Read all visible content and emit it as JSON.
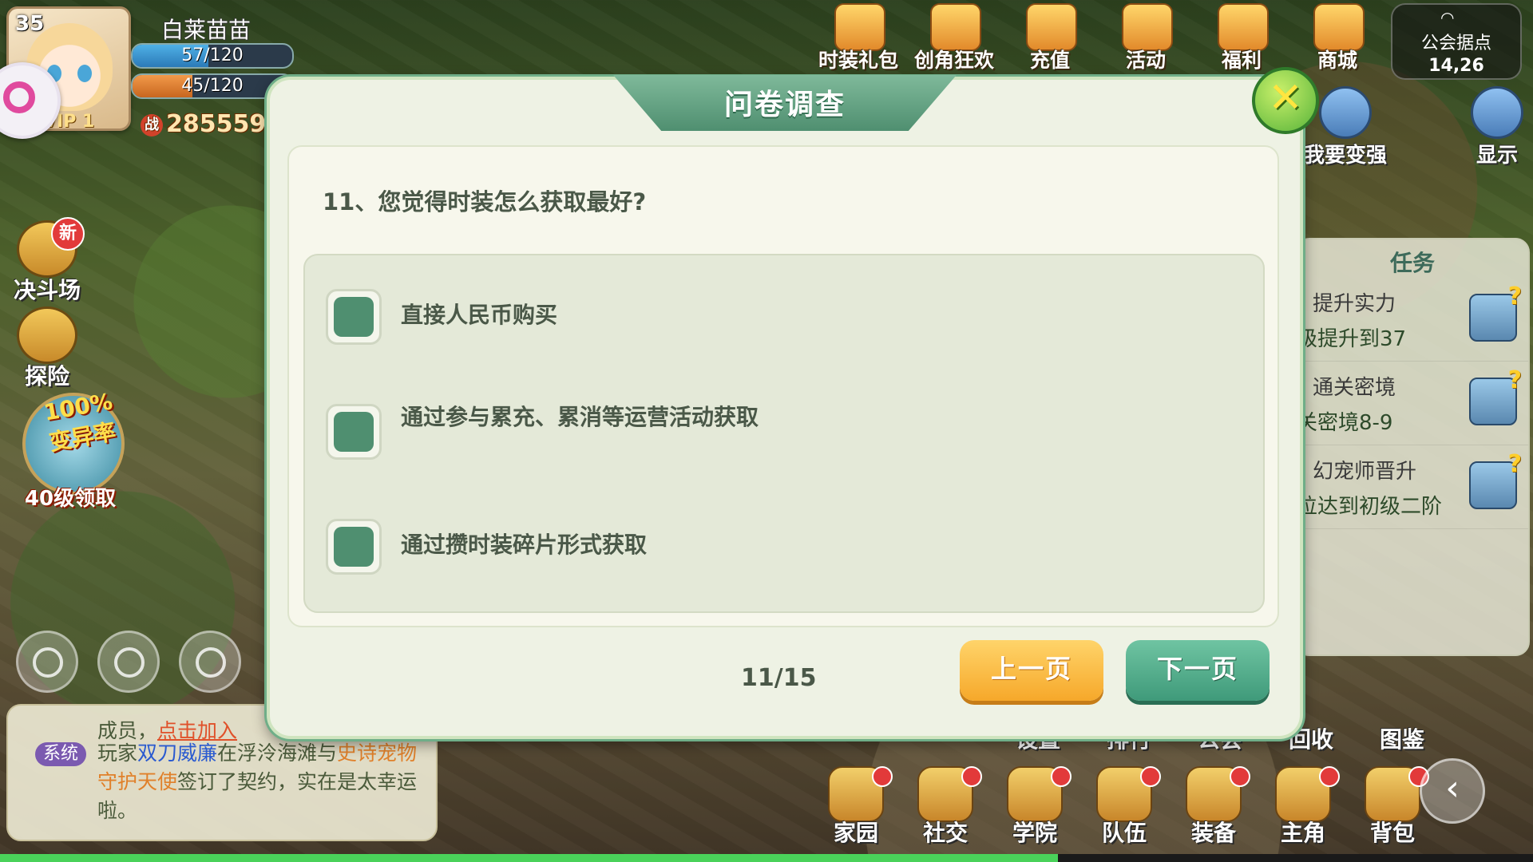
{
  "player": {
    "level": "35",
    "name": "白莱苗苗",
    "hp": "57/120",
    "hp_fill": 0.475,
    "energy": "45/120",
    "energy_fill": 0.375,
    "vip": "VIP 1",
    "power_icon": "战",
    "power": "285559"
  },
  "top_menu": [
    {
      "label": "时装礼包",
      "icon": "gift-icon"
    },
    {
      "label": "创角狂欢",
      "icon": "party-icon"
    },
    {
      "label": "充值",
      "icon": "coin-icon"
    },
    {
      "label": "活动",
      "icon": "event-icon"
    },
    {
      "label": "福利",
      "icon": "welfare-icon"
    },
    {
      "label": "商城",
      "icon": "shop-icon"
    }
  ],
  "guild": {
    "line1": "公会据点",
    "line2": "14,26"
  },
  "side": {
    "strengthen": "我要变强",
    "display": "显示"
  },
  "left_menu": {
    "arena": "决斗场",
    "arena_badge": "新",
    "explore": "探险",
    "promo_big": "100%变异率",
    "promo_label": "40级领取"
  },
  "chat": {
    "line1_prefix": "成员，",
    "line1_link": "点击加入",
    "sys_tag": "系统",
    "msg_a": "玩家",
    "msg_player": "双刀威廉",
    "msg_b": "在浮泠海滩与",
    "msg_rarity": "史诗宠物",
    "msg_pet": "守护天使",
    "msg_c": "签订了契约，实在是太幸运啦。"
  },
  "bottom_row2": [
    "设置",
    "排行",
    "公会",
    "回收",
    "图鉴"
  ],
  "bottom_menu": [
    "家园",
    "社交",
    "学院",
    "队伍",
    "装备",
    "主角",
    "背包"
  ],
  "quest": {
    "title": "任务",
    "items": [
      {
        "name": "提升实力",
        "desc": "级提升到37"
      },
      {
        "name": "通关密境",
        "desc": "关密境8-9"
      },
      {
        "name": "幻宠师晋升",
        "desc": "位达到初级二阶"
      }
    ]
  },
  "dialog": {
    "title": "问卷调查",
    "close": "✕",
    "question": "11、您觉得时装怎么获取最好?",
    "options": [
      "直接人民币购买",
      "通过参与累充、累消等运营活动获取",
      "通过攒时装碎片形式获取"
    ],
    "page": "11/15",
    "prev": "上一页",
    "next": "下一页"
  },
  "exp_progress": 0.69,
  "colors": {
    "accent_green": "#4f8f70",
    "prev_orange": "#f6a82a",
    "dialog_bg": "#eef2e4"
  }
}
